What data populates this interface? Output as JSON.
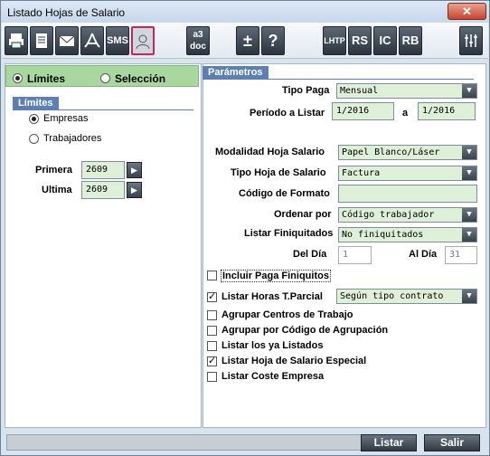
{
  "window": {
    "title": "Listado Hojas de Salario",
    "close_label": "✕"
  },
  "toolbar": {
    "sms": "SMS",
    "a3doc": "a3\ndoc",
    "plusminus": "±",
    "help": "?",
    "lhtp": "LHTP",
    "rs": "RS",
    "ic": "IC",
    "rb": "RB"
  },
  "mode": {
    "limites": "Límites",
    "seleccion": "Selección",
    "selected": "limites"
  },
  "limites_group": {
    "tab": "Límites",
    "empresas": "Empresas",
    "trabajadores": "Trabajadores",
    "selected": "empresas"
  },
  "range": {
    "primera_label": "Primera",
    "primera_value": "2609",
    "ultima_label": "Ultima",
    "ultima_value": "2609"
  },
  "parametros": {
    "tab": "Parámetros",
    "tipo_paga_label": "Tipo Paga",
    "tipo_paga_value": "Mensual",
    "periodo_label": "Período a Listar",
    "periodo_from": "1/2016",
    "periodo_sep": "a",
    "periodo_to": "1/2016",
    "modalidad_label": "Modalidad Hoja Salario",
    "modalidad_value": "Papel Blanco/Láser",
    "tipo_hoja_label": "Tipo Hoja de Salario",
    "tipo_hoja_value": "Factura",
    "codigo_formato_label": "Código de Formato",
    "codigo_formato_value": "",
    "ordenar_label": "Ordenar por",
    "ordenar_value": "Código trabajador",
    "finiquitados_label": "Listar Finiquitados",
    "finiquitados_value": "No finiquitados",
    "del_dia_label": "Del Día",
    "del_dia_value": "1",
    "al_dia_label": "Al Día",
    "al_dia_value": "31"
  },
  "options": [
    {
      "label": "Incluir Paga Finiquitos",
      "checked": false
    },
    {
      "label": "Listar Horas T.Parcial",
      "checked": true,
      "combo": "Según tipo contrato"
    },
    {
      "label": "Agrupar Centros de Trabajo",
      "checked": false
    },
    {
      "label": "Agrupar por Código de Agrupación",
      "checked": false
    },
    {
      "label": "Listar los ya Listados",
      "checked": false
    },
    {
      "label": "Listar Hoja de Salario Especial",
      "checked": true
    },
    {
      "label": "Listar Coste Empresa",
      "checked": false
    }
  ],
  "footer": {
    "listar": "Listar",
    "salir": "Salir"
  },
  "colors": {
    "accent_green": "#a8d8a0",
    "field_green": "#dff0d8",
    "tab_blue": "#5d7fb2",
    "highlight": "#c8245a"
  }
}
